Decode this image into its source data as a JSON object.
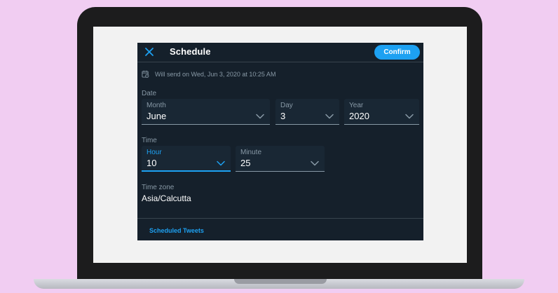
{
  "modal": {
    "title": "Schedule",
    "confirm_label": "Confirm",
    "send_info": "Will send on Wed, Jun 3, 2020 at 10:25 AM"
  },
  "date": {
    "label": "Date",
    "month": {
      "label": "Month",
      "value": "June"
    },
    "day": {
      "label": "Day",
      "value": "3"
    },
    "year": {
      "label": "Year",
      "value": "2020"
    }
  },
  "time": {
    "label": "Time",
    "hour": {
      "label": "Hour",
      "value": "10"
    },
    "minute": {
      "label": "Minute",
      "value": "25"
    }
  },
  "timezone": {
    "label": "Time zone",
    "value": "Asia/Calcutta"
  },
  "footer": {
    "scheduled_link": "Scheduled Tweets"
  },
  "colors": {
    "accent": "#1da1f2",
    "modal_bg": "#15202b",
    "field_bg": "#192734",
    "secondary_text": "#8899a6",
    "page_bg": "#f1cdf2"
  },
  "icons": {
    "close": "close-icon",
    "calendar": "calendar-icon",
    "chevron": "chevron-down-icon"
  }
}
